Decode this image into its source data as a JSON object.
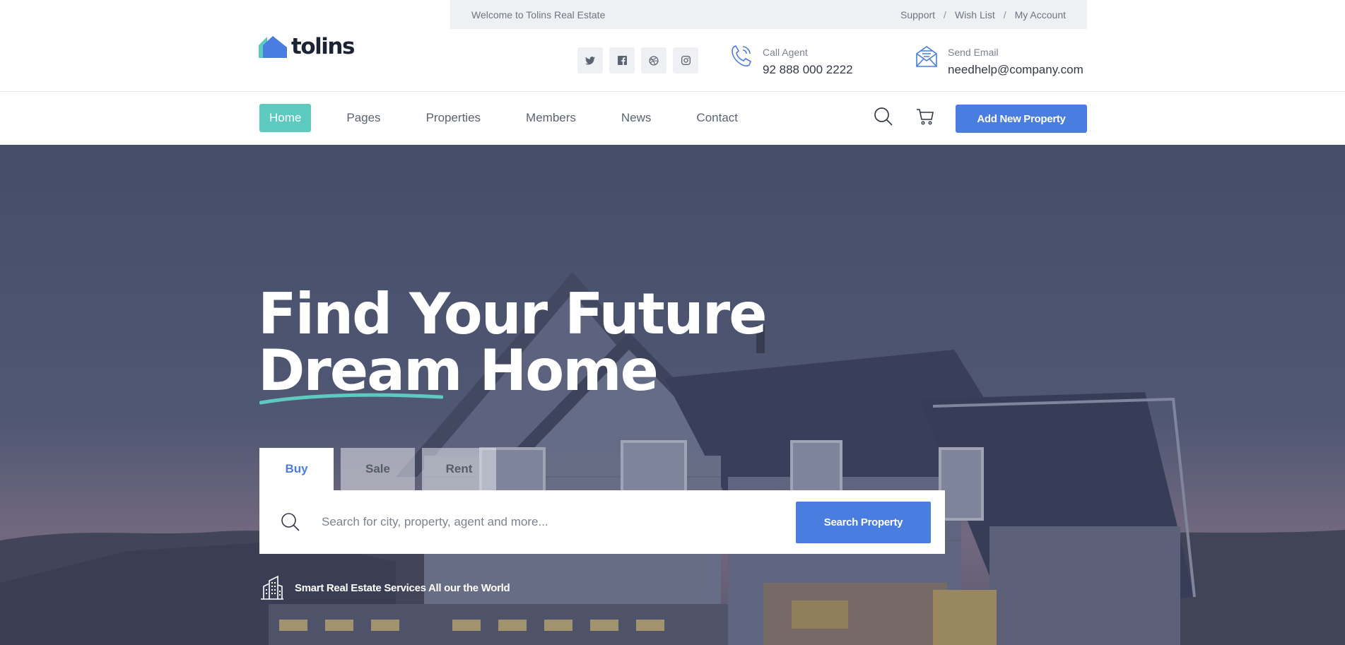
{
  "topbar": {
    "welcome": "Welcome to Tolins Real Estate",
    "links": [
      "Support",
      "Wish List",
      "My Account"
    ],
    "separator": "/"
  },
  "header": {
    "logo_text": "tolins",
    "socials": [
      "twitter-icon",
      "facebook-icon",
      "dribbble-icon",
      "instagram-icon"
    ],
    "call": {
      "label": "Call Agent",
      "value": "92 888 000 2222"
    },
    "email": {
      "label": "Send Email",
      "value": "needhelp@company.com"
    }
  },
  "nav": {
    "items": [
      "Home",
      "Pages",
      "Properties",
      "Members",
      "News",
      "Contact"
    ],
    "active": "Home",
    "add_button": "Add New Property"
  },
  "hero": {
    "title_line1": "Find Your Future",
    "title_line2_a": "Dream",
    "title_line2_b": "Home",
    "tabs": [
      "Buy",
      "Sale",
      "Rent"
    ],
    "active_tab": "Buy",
    "search_placeholder": "Search for city, property, agent and more...",
    "search_button": "Search Property",
    "tagline": "Smart Real Estate Services All our the World"
  },
  "colors": {
    "accent": "#5ec9bf",
    "primary": "#4a7de0",
    "dark": "#1c2434"
  }
}
